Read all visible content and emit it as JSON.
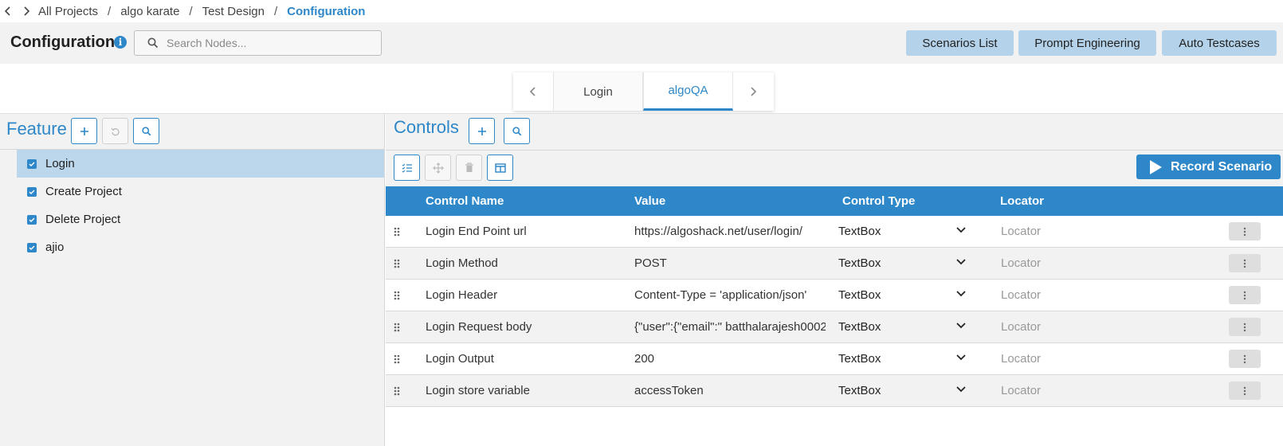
{
  "breadcrumb": {
    "items": [
      "All Projects",
      "algo karate",
      "Test Design"
    ],
    "current": "Configuration",
    "separator": "/"
  },
  "header": {
    "title": "Configuration",
    "info_icon": "i",
    "search_placeholder": "Search Nodes...",
    "buttons": [
      "Scenarios List",
      "Prompt Engineering",
      "Auto Testcases"
    ]
  },
  "tabs": {
    "items": [
      "Login",
      "algoQA"
    ],
    "active": "algoQA"
  },
  "feature_panel": {
    "title": "Feature",
    "items": [
      {
        "label": "Login",
        "checked": true,
        "selected": true
      },
      {
        "label": "Create Project",
        "checked": true,
        "selected": false
      },
      {
        "label": "Delete Project",
        "checked": true,
        "selected": false
      },
      {
        "label": "ajio",
        "checked": true,
        "selected": false
      }
    ]
  },
  "controls_panel": {
    "title": "Controls",
    "record_label": "Record Scenario",
    "columns": [
      "Control Name",
      "Value",
      "Control Type",
      "Locator"
    ],
    "rows": [
      {
        "name": "Login End Point url",
        "value": "https://algoshack.net/user/login/",
        "type": "TextBox",
        "locator": "Locator"
      },
      {
        "name": "Login Method",
        "value": "POST",
        "type": "TextBox",
        "locator": "Locator"
      },
      {
        "name": "Login Header",
        "value": "Content-Type = 'application/json'",
        "type": "TextBox",
        "locator": "Locator"
      },
      {
        "name": "Login Request body",
        "value": "{\"user\":{\"email\":\" batthalarajesh0002",
        "type": "TextBox",
        "locator": "Locator"
      },
      {
        "name": "Login Output",
        "value": "200",
        "type": "TextBox",
        "locator": "Locator"
      },
      {
        "name": "Login store variable",
        "value": "accessToken",
        "type": "TextBox",
        "locator": "Locator"
      }
    ]
  },
  "colors": {
    "accent": "#2d87c8",
    "top_button_bg": "#b4d3ea",
    "selected_row_bg": "#bcd6ec",
    "panel_bg": "#f2f2f2"
  }
}
